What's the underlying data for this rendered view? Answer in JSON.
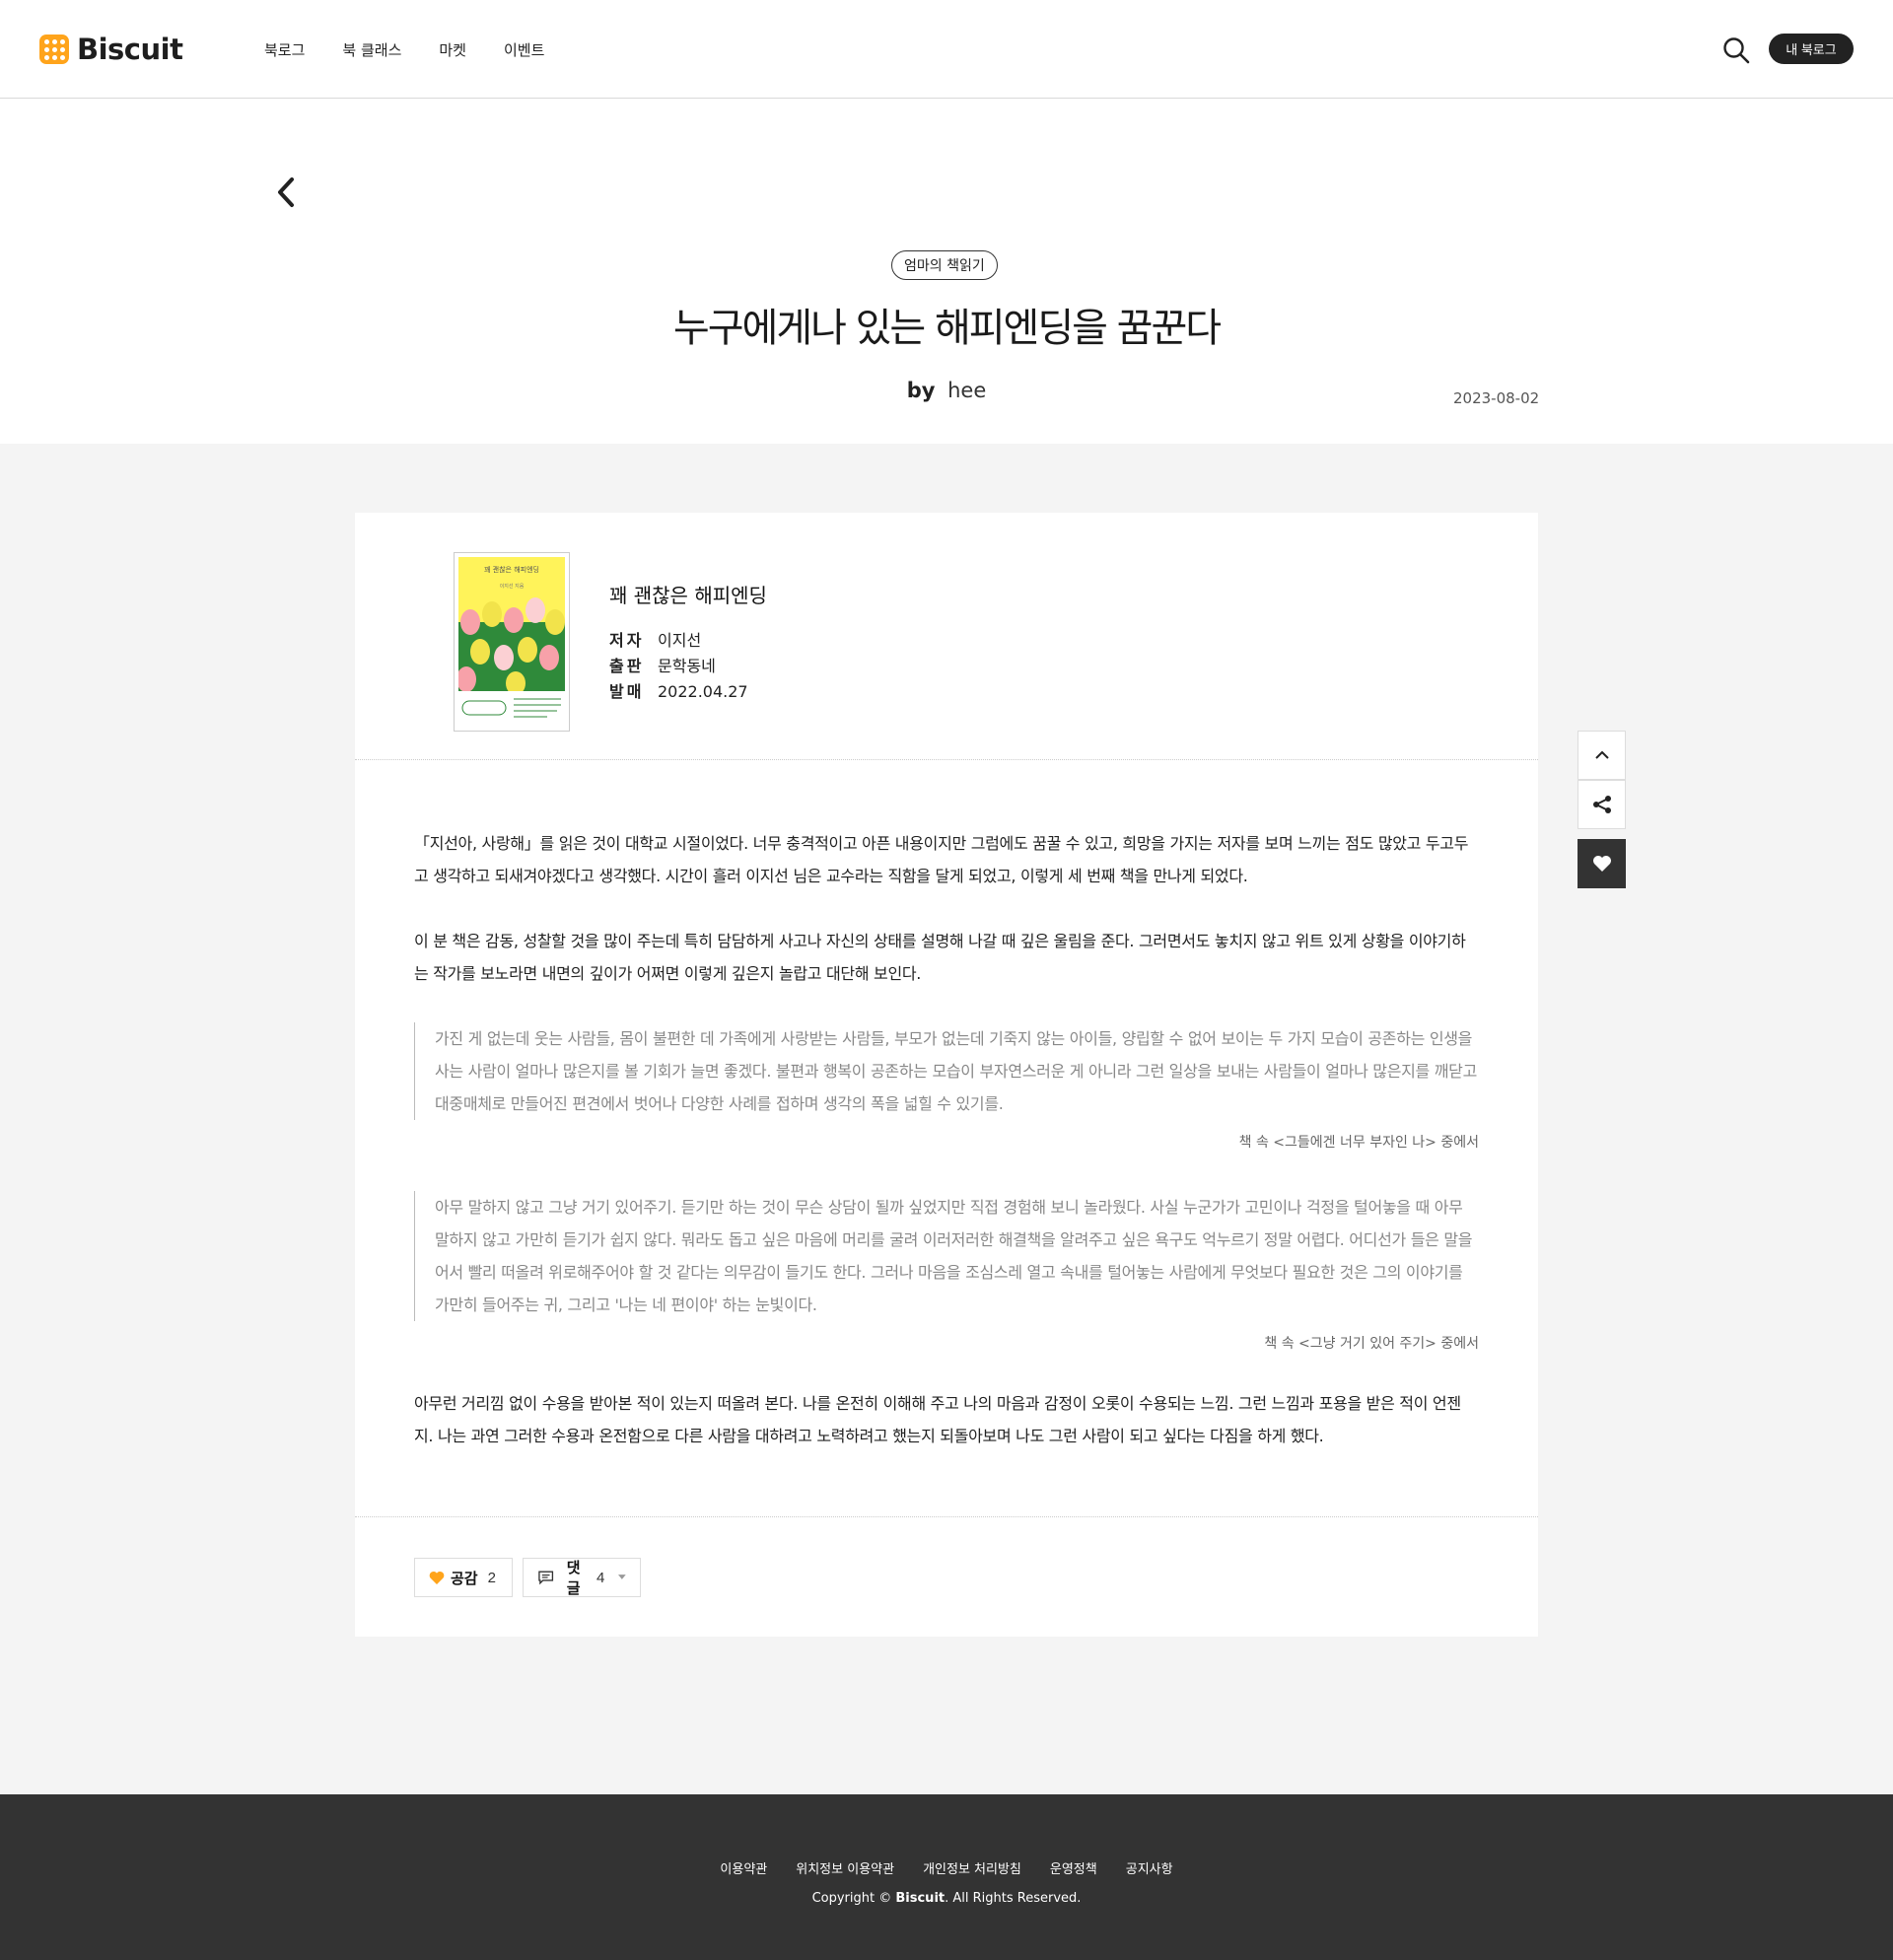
{
  "header": {
    "logo_text": "Biscuit",
    "nav": [
      "북로그",
      "북 클래스",
      "마켓",
      "이벤트"
    ],
    "mylog_button": "내 북로그",
    "accent_color": "#ffa41b"
  },
  "post": {
    "category": "엄마의 책읽기",
    "title": "누구에게나 있는 해피엔딩을 꿈꾼다",
    "by_label": "by",
    "author": "hee",
    "date": "2023-08-02"
  },
  "book": {
    "cover_title": "꽤 괜찮은 해피엔딩",
    "cover_author": "이지선 지음",
    "title": "꽤 괜찮은 해피엔딩",
    "author_label": "저자",
    "author": "이지선",
    "publisher_label": "출판",
    "publisher": "문학동네",
    "release_label": "발매",
    "release_date": "2022.04.27"
  },
  "content": {
    "p1": "「지선아, 사랑해」를 읽은 것이 대학교 시절이었다. 너무 충격적이고 아픈 내용이지만 그럼에도 꿈꿀 수 있고, 희망을 가지는 저자를 보며 느끼는 점도 많았고 두고두고 생각하고 되새겨야겠다고 생각했다. 시간이 흘러 이지선 님은 교수라는 직함을 달게 되었고, 이렇게 세 번째 책을 만나게 되었다.",
    "p2": "이 분 책은 감동, 성찰할 것을 많이 주는데 특히 담담하게 사고나 자신의 상태를 설명해 나갈 때 깊은 울림을 준다. 그러면서도 놓치지 않고 위트 있게 상황을 이야기하는 작가를 보노라면 내면의 깊이가 어쩌면 이렇게 깊은지 놀랍고 대단해 보인다.",
    "quote1": "가진 게 없는데 웃는 사람들, 몸이 불편한 데 가족에게 사랑받는 사람들, 부모가 없는데 기죽지 않는 아이들, 양립할 수 없어 보이는 두 가지 모습이 공존하는 인생을 사는 사람이 얼마나 많은지를 볼 기회가 늘면 좋겠다. 불편과 행복이 공존하는 모습이 부자연스러운 게 아니라 그런 일상을 보내는 사람들이 얼마나 많은지를 깨닫고 대중매체로 만들어진 편견에서 벗어나 다양한 사례를 접하며 생각의 폭을 넓힐 수 있기를.",
    "quote1_source": "책 속  <그들에겐 너무 부자인 나> 중에서",
    "quote2": "아무 말하지 않고 그냥 거기 있어주기. 듣기만 하는 것이 무슨 상담이 될까 싶었지만 직접 경험해 보니 놀라웠다. 사실 누군가가 고민이나 걱정을 털어놓을 때 아무 말하지 않고 가만히 듣기가 쉽지 않다. 뭐라도 돕고 싶은 마음에 머리를 굴려 이러저러한 해결책을 알려주고 싶은 욕구도 억누르기 정말 어렵다. 어디선가 들은 말을 어서 빨리 떠올려 위로해주어야 할 것 같다는 의무감이 들기도 한다. 그러나 마음을 조심스레 열고 속내를 털어놓는 사람에게 무엇보다 필요한 것은 그의 이야기를 가만히 들어주는 귀, 그리고 '나는 네 편이야' 하는 눈빛이다.",
    "quote2_source": "책 속  <그냥 거기 있어 주기> 중에서",
    "p3": "아무런 거리낌 없이 수용을 받아본 적이 있는지 떠올려 본다. 나를 온전히 이해해 주고 나의 마음과 감정이 오롯이 수용되는 느낌. 그런 느낌과 포용을 받은 적이 언젠지. 나는 과연 그러한 수용과 온전함으로 다른 사람을 대하려고 노력하려고 했는지 되돌아보며 나도 그런 사람이 되고 싶다는 다짐을 하게 했다."
  },
  "actions": {
    "like_label": "공감",
    "like_count": "2",
    "comment_label": "댓글",
    "comment_count": "4"
  },
  "footer": {
    "links": [
      "이용약관",
      "위치정보 이용약관",
      "개인정보 처리방침",
      "운영정책",
      "공지사항"
    ],
    "copyright_prefix": "Copyright © ",
    "copyright_brand": "Biscuit",
    "copyright_suffix": ". All Rights Reserved."
  }
}
